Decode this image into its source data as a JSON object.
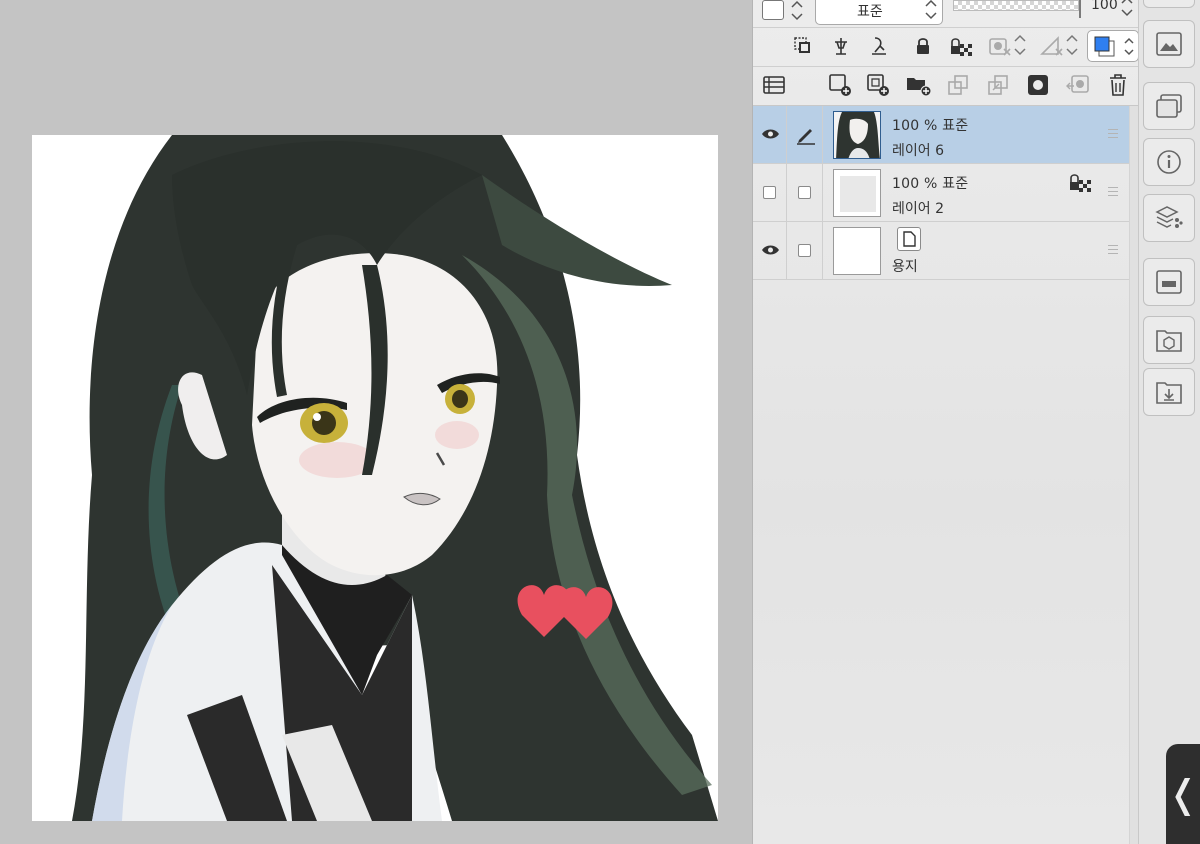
{
  "layer_panel": {
    "blend_mode_select": "표준",
    "opacity_value": "100",
    "layers": [
      {
        "visible": true,
        "selected": true,
        "opacity_mode": "100 % 표준",
        "name": "레이어 6",
        "locked_transparency": false
      },
      {
        "visible": false,
        "selected": false,
        "opacity_mode": "100 % 표준",
        "name": "레이어 2",
        "locked_transparency": true
      },
      {
        "visible": true,
        "selected": false,
        "opacity_mode": "",
        "name": "용지",
        "is_paper": true
      }
    ]
  },
  "collapse_tab": {
    "glyph": "❬"
  },
  "colors": {
    "selected_row": "#b8cfe6",
    "heart": "#e8505f",
    "layer_color_swatch": "#2f7ff0"
  }
}
